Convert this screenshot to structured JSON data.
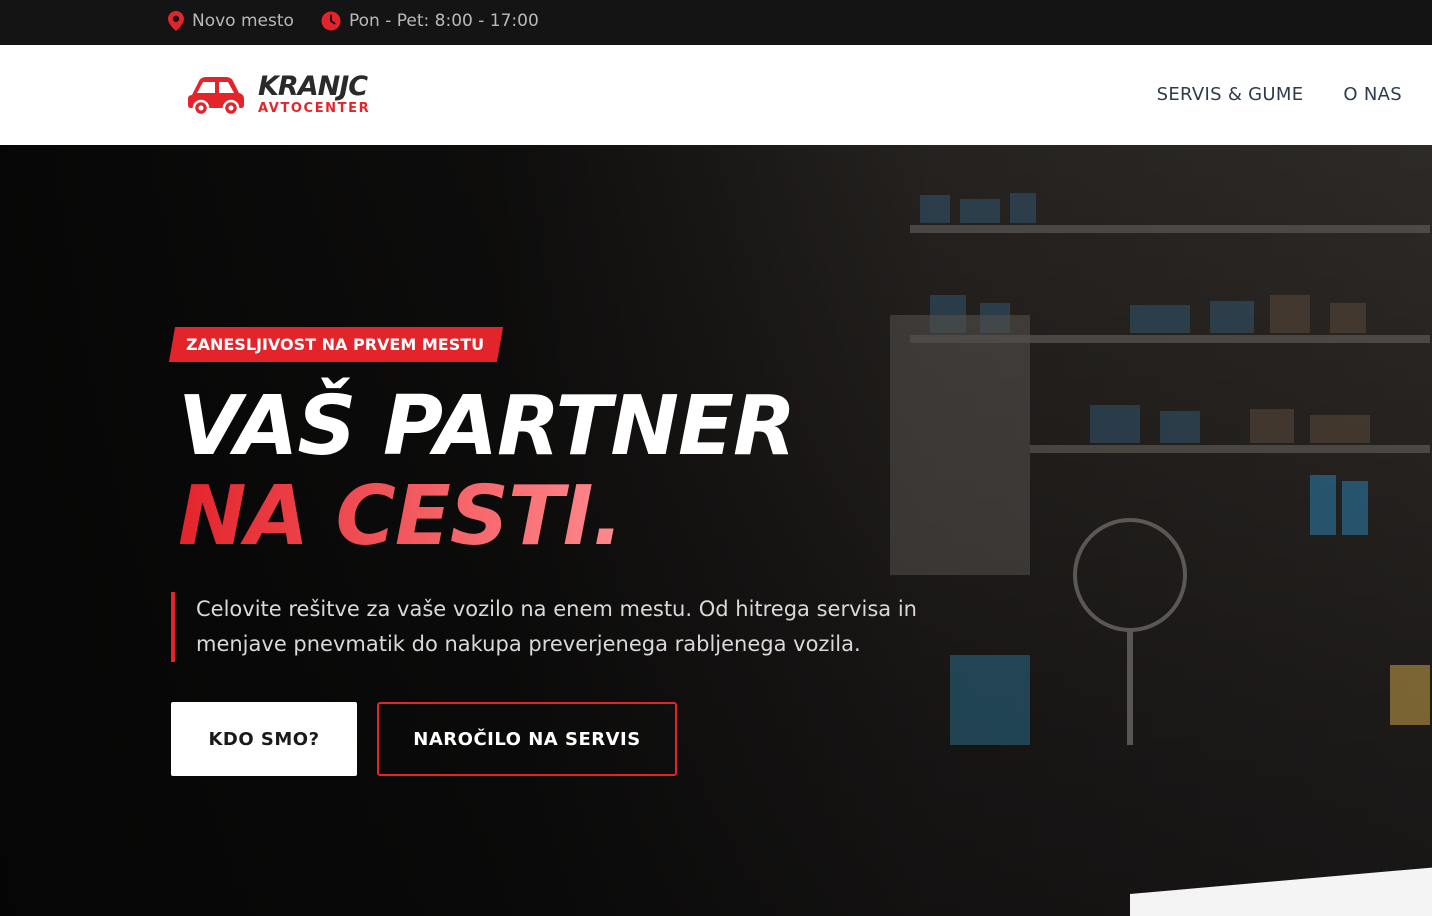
{
  "topbar": {
    "location": "Novo mesto",
    "location_icon": "map-pin-icon",
    "hours": "Pon - Pet: 8:00 - 17:00",
    "hours_icon": "clock-icon"
  },
  "header": {
    "logo_brand": "KRANJC",
    "logo_sub": "AVTOCENTER",
    "logo_icon": "car-icon",
    "nav": [
      {
        "label": "SERVIS & GUME"
      },
      {
        "label": "O NAS"
      }
    ]
  },
  "hero": {
    "tag": "ZANESLJIVOST NA PRVEM MESTU",
    "title_line1": "VAŠ PARTNER",
    "title_line2": "NA CESTI.",
    "lead": "Celovite rešitve za vaše vozilo na enem mestu. Od hitrega servisa in menjave pnevmatik do nakupa preverjenega rabljenega vozila.",
    "primary_button": "KDO SMO?",
    "secondary_button": "NAROČILO NA SERVIS"
  },
  "colors": {
    "accent": "#e3242b",
    "topbar_bg": "#141414",
    "header_bg": "#ffffff",
    "nav_text": "#2f3a4a"
  }
}
